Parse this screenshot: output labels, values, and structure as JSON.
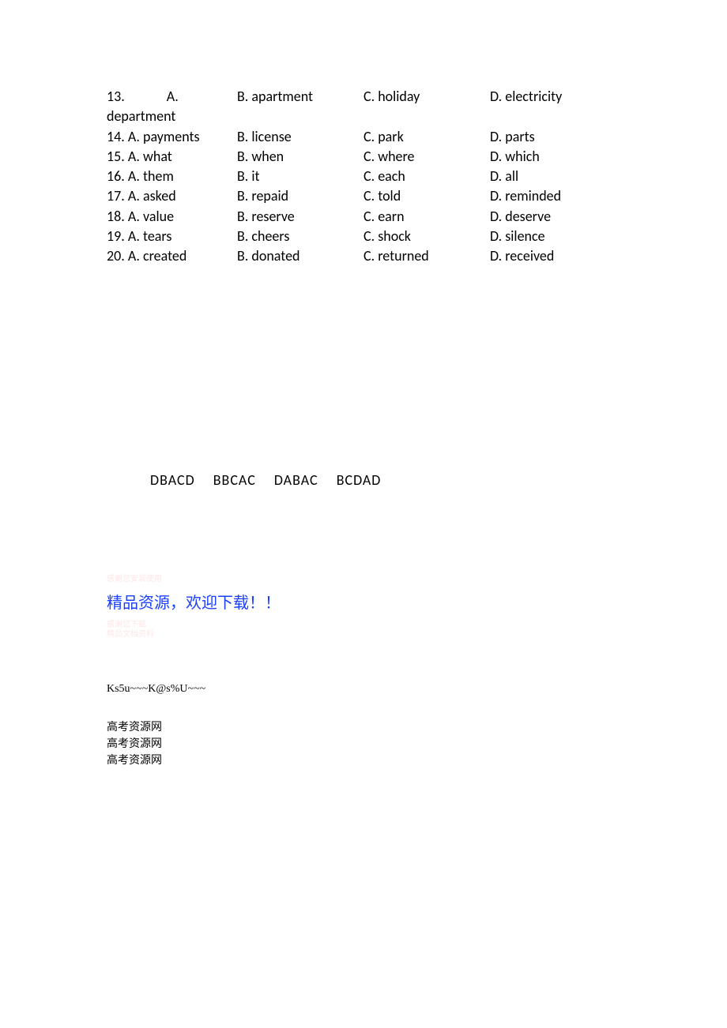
{
  "questions": [
    {
      "num": "13.",
      "a": "A. department",
      "b": "B. apartment",
      "c": "C. holiday",
      "d": "D. electricity"
    },
    {
      "num": "14.",
      "a": "A. payments",
      "b": "B. license",
      "c": "C. park",
      "d": "D. parts"
    },
    {
      "num": "15.",
      "a": "A. what",
      "b": "B. when",
      "c": "C. where",
      "d": "D. which"
    },
    {
      "num": "16.",
      "a": "A. them",
      "b": "B. it",
      "c": "C. each",
      "d": "D. all"
    },
    {
      "num": "17.",
      "a": "A. asked",
      "b": "B. repaid",
      "c": "C. told",
      "d": "D. reminded"
    },
    {
      "num": "18.",
      "a": "A. value",
      "b": "B. reserve",
      "c": "C. earn",
      "d": "D. deserve"
    },
    {
      "num": "19.",
      "a": "A. tears",
      "b": "B. cheers",
      "c": "C. shock",
      "d": "D. silence"
    },
    {
      "num": "20.",
      "a": "A. created",
      "b": "B. donated",
      "c": "C. returned",
      "d": "D. received"
    }
  ],
  "q13_wrap_second_line": "department",
  "answers": {
    "g1": "DBACD",
    "g2": "BBCAC",
    "g3": "DABAC",
    "g4": "BCDAD"
  },
  "watermark1": "感谢您安装使用",
  "blue_line": "精品资源，欢迎下载！！",
  "watermark2_line1": "感谢您下载",
  "watermark2_line2": "精品文档资料",
  "code_line": "Ks5u~~~K@s%U~~~",
  "cn_repeat_line": "高考资源网"
}
